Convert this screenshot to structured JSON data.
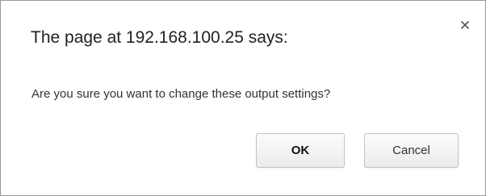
{
  "dialog": {
    "title": "The page at 192.168.100.25 says:",
    "message": "Are you sure you want to change these output settings?",
    "close_icon": "close-icon",
    "ok_label": "OK",
    "cancel_label": "Cancel"
  }
}
